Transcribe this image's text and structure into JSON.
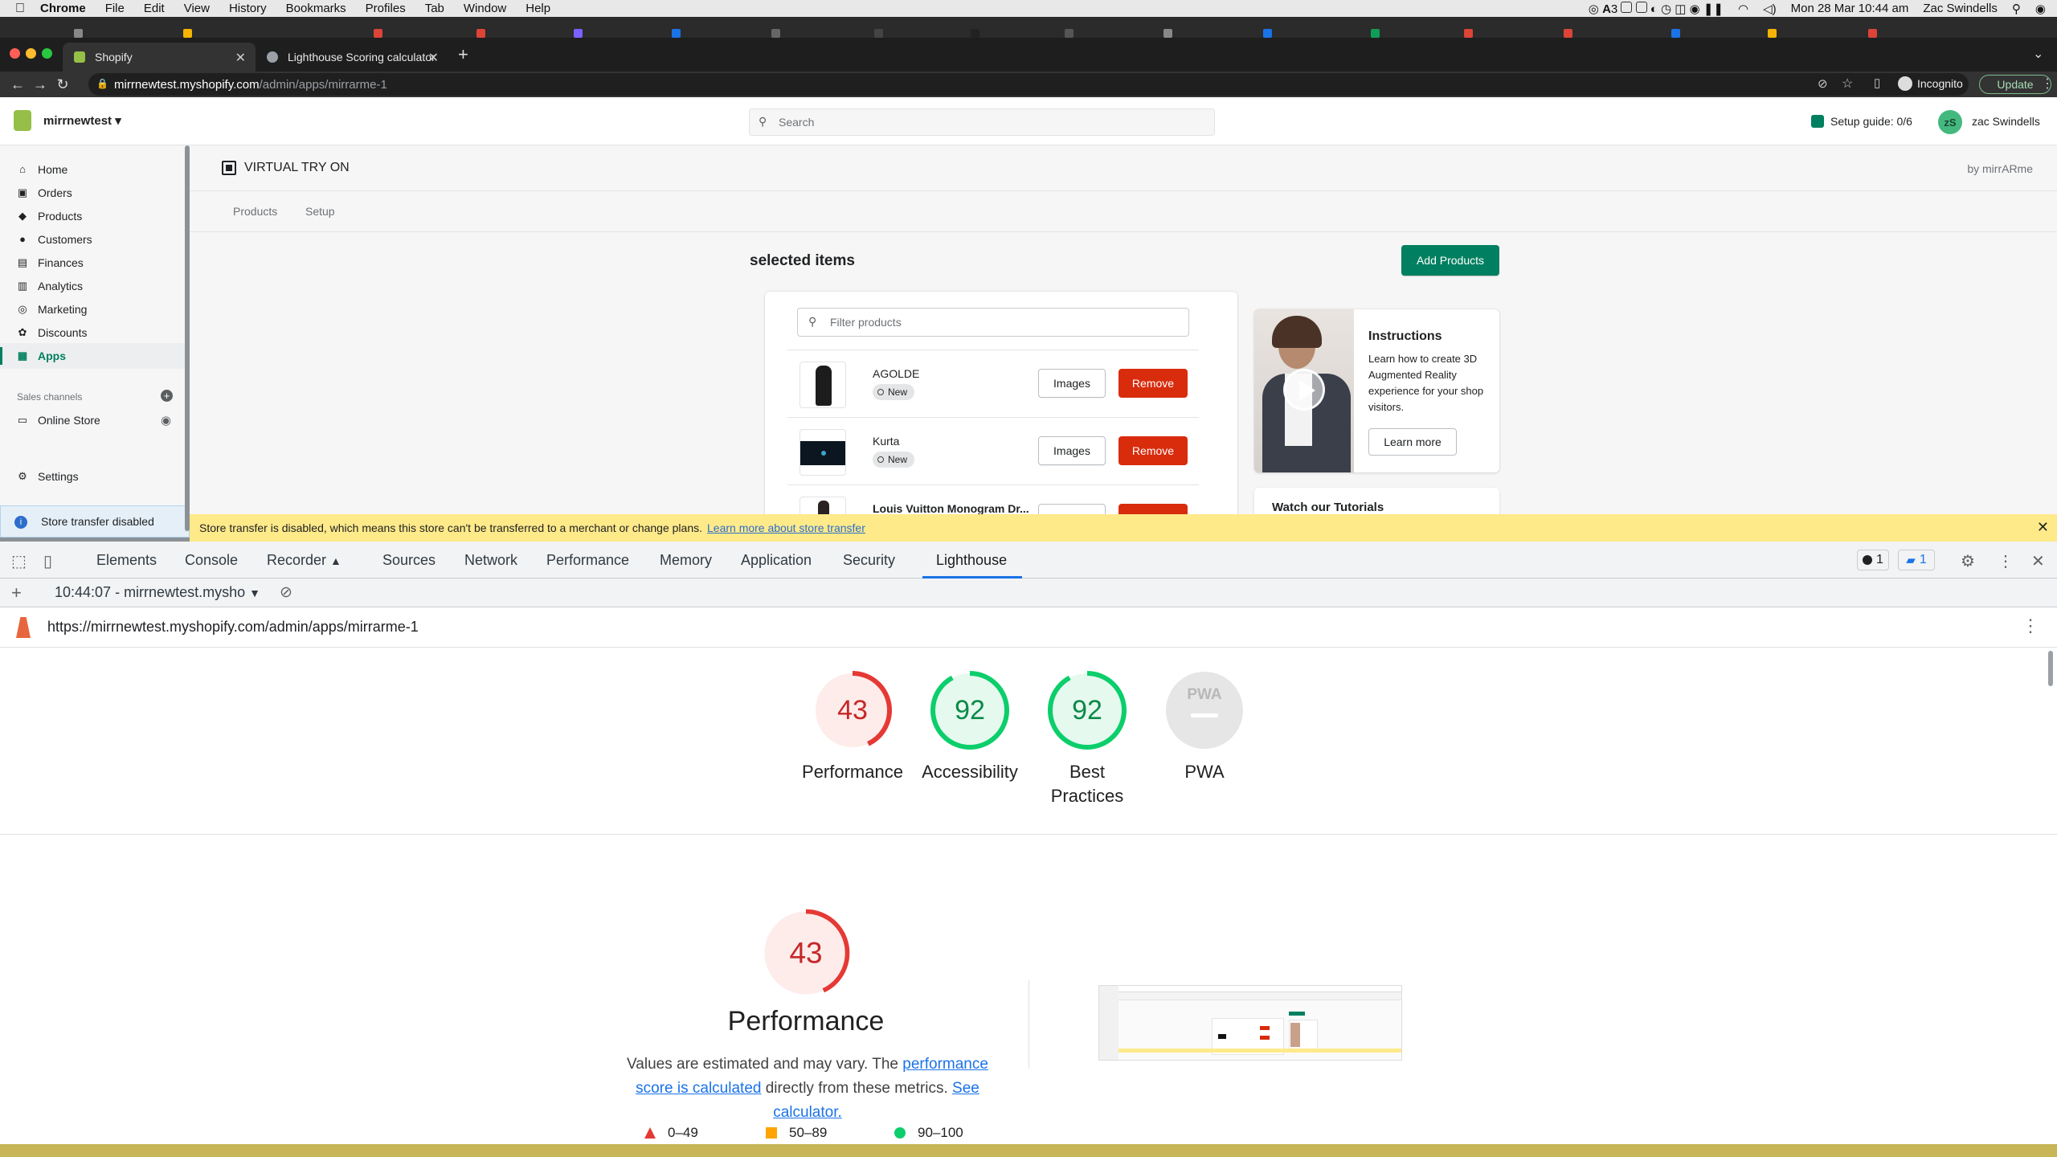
{
  "menubar": {
    "app": "Chrome",
    "items": [
      "File",
      "Edit",
      "View",
      "History",
      "Bookmarks",
      "Profiles",
      "Tab",
      "Window",
      "Help"
    ],
    "badge_count": "3",
    "clock": "Mon 28 Mar  10:44 am",
    "user": "Zac Swindells"
  },
  "tabs": [
    {
      "title": "Shopify",
      "active": true
    },
    {
      "title": "Lighthouse Scoring calculator",
      "active": false
    }
  ],
  "omnibox": {
    "host": "mirrnewtest.myshopify.com",
    "path": "/admin/apps/mirrarme-1",
    "incognito_label": "Incognito",
    "update_label": "Update"
  },
  "shopify": {
    "store_name": "mirrnewtest",
    "search_placeholder": "Search",
    "setup_guide": "Setup guide: 0/6",
    "avatar_initials": "zS",
    "user_name": "zac Swindells",
    "nav": [
      {
        "label": "Home",
        "icon": "home-icon"
      },
      {
        "label": "Orders",
        "icon": "orders-icon"
      },
      {
        "label": "Products",
        "icon": "tag-icon"
      },
      {
        "label": "Customers",
        "icon": "person-icon"
      },
      {
        "label": "Finances",
        "icon": "finance-icon"
      },
      {
        "label": "Analytics",
        "icon": "bar-chart-icon"
      },
      {
        "label": "Marketing",
        "icon": "target-icon"
      },
      {
        "label": "Discounts",
        "icon": "discount-icon"
      },
      {
        "label": "Apps",
        "icon": "apps-icon"
      }
    ],
    "sales_channels_label": "Sales channels",
    "online_store": "Online Store",
    "settings": "Settings",
    "transfer_notice": "Store transfer disabled"
  },
  "app": {
    "title": "VIRTUAL TRY ON",
    "by": "by mirrARme",
    "tabs": [
      "Products",
      "Setup"
    ],
    "selected_title": "selected items",
    "add_products": "Add Products",
    "filter_placeholder": "Filter products",
    "products": [
      {
        "name": "AGOLDE",
        "status": "New"
      },
      {
        "name": "Kurta",
        "status": "New"
      },
      {
        "name": "Louis Vuitton Monogram Dr...",
        "status": ""
      }
    ],
    "images_label": "Images",
    "remove_label": "Remove",
    "instructions_title": "Instructions",
    "instructions_text": "Learn how to create 3D Augmented Reality experience for your shop visitors.",
    "learn_more": "Learn more",
    "tutorials_title": "Watch our Tutorials"
  },
  "banner": {
    "text": "Store transfer is disabled, which means this store can't be transferred to a merchant or change plans.",
    "link": "Learn more about store transfer"
  },
  "devtools": {
    "tabs": [
      "Elements",
      "Console",
      "Recorder",
      "Sources",
      "Network",
      "Performance",
      "Memory",
      "Application",
      "Security",
      "Lighthouse"
    ],
    "active_tab": "Lighthouse",
    "error_count": "1",
    "message_count": "1",
    "report_select": "10:44:07 - mirrnewtest.mysho",
    "url": "https://mirrnewtest.myshopify.com/admin/apps/mirrarme-1"
  },
  "lighthouse": {
    "scores": [
      {
        "label": "Performance",
        "value": 43,
        "color": "#e53935",
        "bg": "#fdecea"
      },
      {
        "label": "Accessibility",
        "value": 92,
        "color": "#0cce6b",
        "bg": "#e6f9ef"
      },
      {
        "label": "Best Practices",
        "value": 92,
        "color": "#0cce6b",
        "bg": "#e6f9ef"
      },
      {
        "label": "PWA",
        "value": null,
        "color": "#c4c4c4",
        "bg": "#e8e8e8"
      }
    ],
    "pwa_text": "PWA",
    "main_score": 43,
    "main_label": "Performance",
    "desc_prefix": "Values are estimated and may vary. The ",
    "desc_link1": "performance score is calculated",
    "desc_middle": " directly from these metrics. ",
    "desc_link2": "See calculator.",
    "legend": [
      {
        "range": "0–49",
        "color": "#e53935",
        "shape": "triangle"
      },
      {
        "range": "50–89",
        "color": "#ffa400",
        "shape": "square"
      },
      {
        "range": "90–100",
        "color": "#0cce6b",
        "shape": "circle"
      }
    ]
  }
}
